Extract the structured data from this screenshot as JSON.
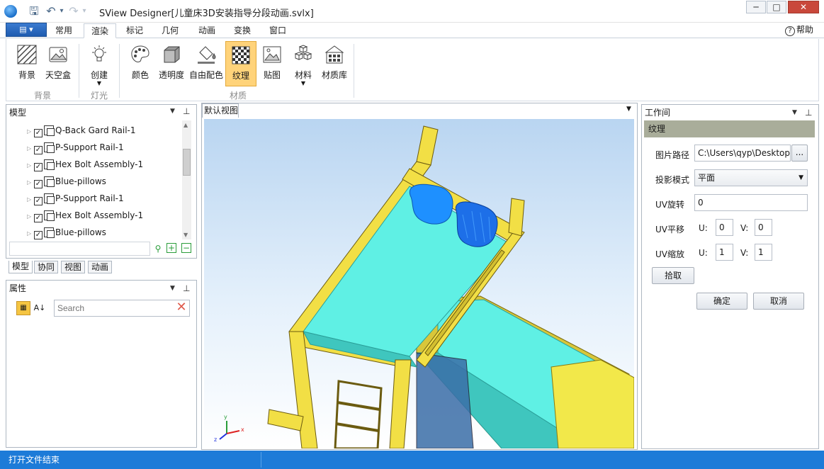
{
  "window": {
    "title": "SView Designer[儿童床3D安装指导分段动画.svlx]",
    "minimize": "─",
    "maximize": "□",
    "close": "✕"
  },
  "quick_access": {
    "save": "🖫",
    "undo": "↶",
    "redo": "↷",
    "more": "▾"
  },
  "file_menu": {
    "label": "▤ ▾"
  },
  "tabs": [
    "常用",
    "渲染",
    "标记",
    "几何",
    "动画",
    "变换",
    "窗口"
  ],
  "active_tab": "渲染",
  "help": {
    "label": "帮助",
    "icon": "?"
  },
  "ribbon": {
    "background_group": {
      "label": "背景",
      "buttons": [
        "背景",
        "天空盒"
      ]
    },
    "light_group": {
      "label": "灯光",
      "buttons": [
        "创建"
      ]
    },
    "material_group": {
      "label": "材质",
      "buttons": [
        "颜色",
        "透明度",
        "自由配色",
        "纹理",
        "贴图",
        "材料",
        "材质库"
      ],
      "active": "纹理"
    }
  },
  "model_panel": {
    "title": "模型",
    "items": [
      "Q-Back Gard Rail-1",
      "P-Support Rail-1",
      "Hex Bolt Assembly-1",
      "Blue-pillows",
      "P-Support Rail-1",
      "Hex Bolt Assembly-1",
      "Blue-pillows"
    ],
    "search_placeholder": "",
    "bottom_tabs": [
      "模型",
      "协同",
      "视图",
      "动画"
    ]
  },
  "properties_panel": {
    "title": "属性",
    "search_placeholder": "Search"
  },
  "viewport": {
    "tab_label": "默认视图",
    "axis_labels": {
      "x": "x",
      "y": "y",
      "z": "z"
    }
  },
  "workspace_panel": {
    "title": "工作间",
    "section": "纹理",
    "image_path_label": "图片路径",
    "image_path_value": "C:\\Users\\qyp\\Desktop\\",
    "browse_label": "...",
    "projection_label": "投影模式",
    "projection_value": "平面",
    "uv_rotate_label": "UV旋转",
    "uv_rotate_value": "0",
    "uv_translate_label": "UV平移",
    "uv_translate_u": "0",
    "uv_translate_v": "0",
    "uv_scale_label": "UV缩放",
    "uv_scale_u": "1",
    "uv_scale_v": "1",
    "u_label": "U:",
    "v_label": "V:",
    "pick_label": "拾取",
    "ok_label": "确定",
    "cancel_label": "取消"
  },
  "status": {
    "text": "打开文件结束"
  },
  "colors": {
    "accent": "#1d7bd8",
    "active_ribbon": "#ffd37a",
    "section_header": "#a9ad9a",
    "bed_frame": "#f2df45",
    "mattress": "#5ff0e4",
    "pillow": "#1e90ff"
  }
}
